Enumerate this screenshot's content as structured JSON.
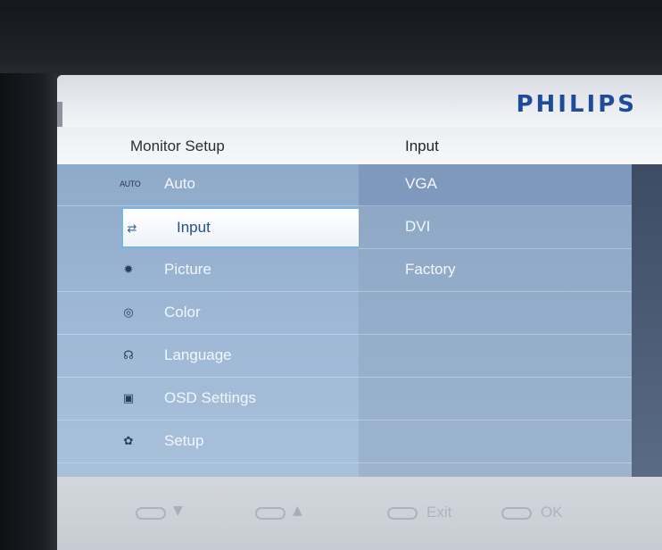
{
  "osd": {
    "brand": "PHILIPS",
    "title_left": "Monitor Setup",
    "title_right": "Input",
    "menu": [
      {
        "label": "Auto",
        "icon": "AUTO",
        "icon_name": "auto-icon",
        "selected": false
      },
      {
        "label": "Input",
        "icon": "⇄",
        "icon_name": "input-icon",
        "selected": true
      },
      {
        "label": "Picture",
        "icon": "✹",
        "icon_name": "brightness-icon",
        "selected": false
      },
      {
        "label": "Color",
        "icon": "◎",
        "icon_name": "color-icon",
        "selected": false
      },
      {
        "label": "Language",
        "icon": "☊",
        "icon_name": "language-icon",
        "selected": false
      },
      {
        "label": "OSD Settings",
        "icon": "▣",
        "icon_name": "osd-icon",
        "selected": false
      },
      {
        "label": "Setup",
        "icon": "✿",
        "icon_name": "gear-icon",
        "selected": false
      }
    ],
    "submenu": [
      {
        "label": "VGA",
        "highlighted": true
      },
      {
        "label": "DVI",
        "highlighted": false
      },
      {
        "label": "Factory",
        "highlighted": false
      },
      {
        "label": "",
        "highlighted": false
      },
      {
        "label": "",
        "highlighted": false
      },
      {
        "label": "",
        "highlighted": false
      },
      {
        "label": "",
        "highlighted": false
      }
    ],
    "footer": {
      "down_symbol": "▼",
      "up_symbol": "▲",
      "exit_label": "Exit",
      "ok_label": "OK"
    }
  },
  "colors": {
    "brand_blue": "#1f4c9a",
    "menu_blue": "#9fb9d6",
    "selection_border": "#74b7e4"
  }
}
